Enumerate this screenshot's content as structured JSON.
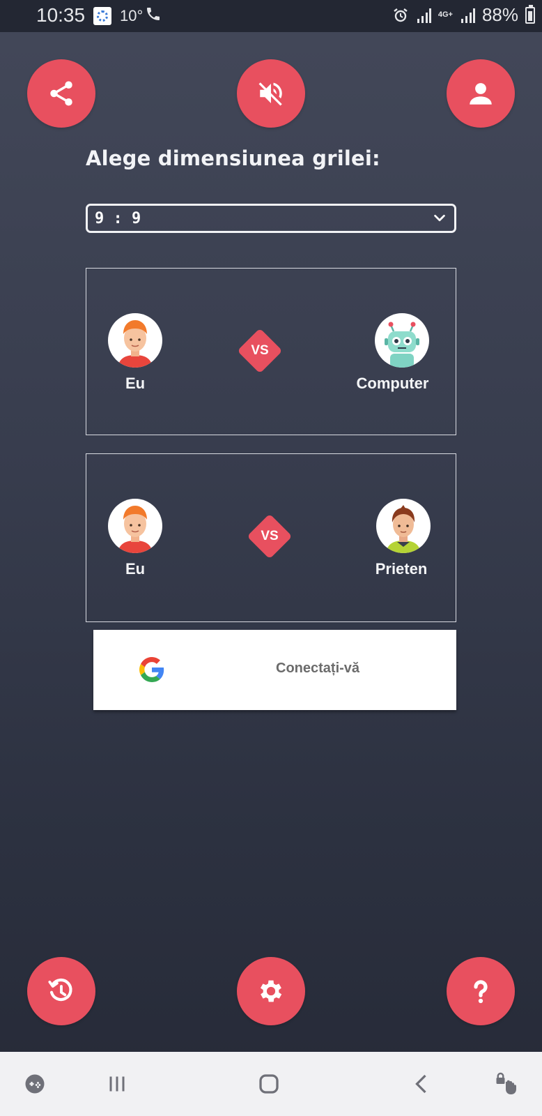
{
  "status_bar": {
    "time": "10:35",
    "temperature": "10°",
    "network": "4G+",
    "battery": "88%"
  },
  "top_buttons": {
    "share_icon": "share-icon",
    "sound_icon": "volume-off-icon",
    "profile_icon": "person-icon"
  },
  "grid": {
    "prompt": "Alege dimensiunea grilei:",
    "selected": "9 : 9"
  },
  "modes": [
    {
      "player1": "Eu",
      "vs": "VS",
      "player2": "Computer"
    },
    {
      "player1": "Eu",
      "vs": "VS",
      "player2": "Prieten"
    }
  ],
  "signin": {
    "label": "Conectați-vă"
  },
  "bottom_buttons": {
    "history_icon": "history-icon",
    "settings_icon": "gear-icon",
    "help_icon": "help-icon"
  },
  "colors": {
    "accent": "#e8505f",
    "background_top": "#434859",
    "background_bottom": "#262a37"
  }
}
